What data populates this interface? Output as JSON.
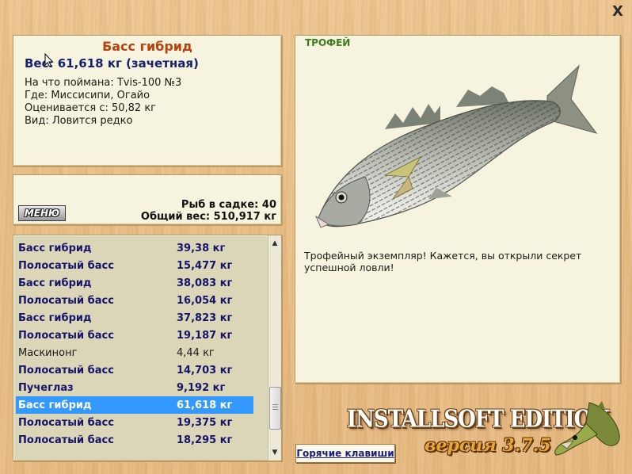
{
  "window": {
    "close_symbol": "X"
  },
  "info": {
    "title": "Басс гибрид",
    "weight": "Вес: 61,618 кг (зачетная)",
    "bait": "На что поймана: Tvis-100 №3",
    "location": "Где: Миссисипи, Огайо",
    "valued_from": "Оценивается с: 50,82 кг",
    "rarity": "Вид: Ловится редко"
  },
  "stats": {
    "menu_label": "МЕНЮ",
    "fish_in_keepnet": "Рыб в садке: 40",
    "total_weight": "Общий вес: 510,917 кг"
  },
  "catch_list": [
    {
      "name": "Басс гибрид",
      "weight": "39,38 кг",
      "trophy": true,
      "selected": false
    },
    {
      "name": "Полосатый басс",
      "weight": "15,477 кг",
      "trophy": true,
      "selected": false
    },
    {
      "name": "Басс гибрид",
      "weight": "38,083 кг",
      "trophy": true,
      "selected": false
    },
    {
      "name": "Полосатый басс",
      "weight": "16,054 кг",
      "trophy": true,
      "selected": false
    },
    {
      "name": "Басс гибрид",
      "weight": "37,823 кг",
      "trophy": true,
      "selected": false
    },
    {
      "name": "Полосатый басс",
      "weight": "19,187 кг",
      "trophy": true,
      "selected": false
    },
    {
      "name": "Маскинонг",
      "weight": "4,44 кг",
      "trophy": false,
      "selected": false
    },
    {
      "name": "Полосатый басс",
      "weight": "14,703 кг",
      "trophy": true,
      "selected": false
    },
    {
      "name": "Пучеглаз",
      "weight": "9,192 кг",
      "trophy": true,
      "selected": false
    },
    {
      "name": "Басс гибрид",
      "weight": "61,618 кг",
      "trophy": true,
      "selected": true
    },
    {
      "name": "Полосатый басс",
      "weight": "19,375 кг",
      "trophy": true,
      "selected": false
    },
    {
      "name": "Полосатый басс",
      "weight": "18,295 кг",
      "trophy": true,
      "selected": false
    }
  ],
  "trophy": {
    "label": "ТРОФЕЙ",
    "description": "Трофейный экземпляр! Кажется, вы открыли секрет успешной ловли!"
  },
  "branding": {
    "edition": "INSTALLSOFT EDITION",
    "version": "версия 3.7.5"
  },
  "hotkeys_label": "Горячие клавиши",
  "colors": {
    "title": "#b8420e",
    "trophy_label": "#3e7a1e",
    "list_text": "#15156b",
    "selection": "#3399ff",
    "panel_bg": "#f6f3de"
  },
  "icons": [
    "close-icon",
    "cursor-icon",
    "scroll-up-icon",
    "scroll-down-icon",
    "fish-image",
    "pike-logo"
  ]
}
